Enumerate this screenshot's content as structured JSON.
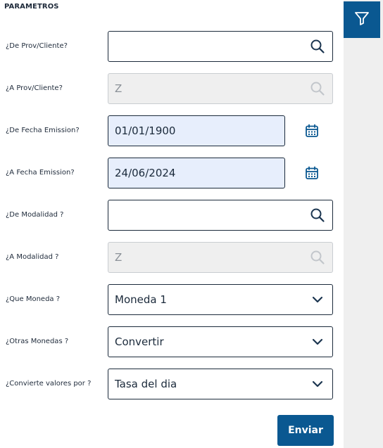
{
  "section_title": "PARAMETROS",
  "fields": [
    {
      "label": "¿De Prov/Cliente?",
      "value": "",
      "type": "lookup",
      "enabled": true
    },
    {
      "label": "¿A Prov/Cliente?",
      "value": "Z",
      "type": "lookup",
      "enabled": false
    },
    {
      "label": "¿De Fecha Emission?",
      "value": "01/01/1900",
      "type": "date",
      "enabled": true
    },
    {
      "label": "¿A Fecha Emission?",
      "value": "24/06/2024",
      "type": "date",
      "enabled": true
    },
    {
      "label": "¿De Modalidad ?",
      "value": "",
      "type": "lookup",
      "enabled": true
    },
    {
      "label": "¿A Modalidad ?",
      "value": "Z",
      "type": "lookup",
      "enabled": false
    },
    {
      "label": "¿Que Moneda ?",
      "value": "Moneda 1",
      "type": "select",
      "enabled": true
    },
    {
      "label": "¿Otras Monedas ?",
      "value": "Convertir",
      "type": "select",
      "enabled": true
    },
    {
      "label": "¿Convierte valores por ?",
      "value": "Tasa del dia",
      "type": "select",
      "enabled": true
    }
  ],
  "submit_label": "Enviar",
  "icons": {
    "filter": "filter-icon",
    "lookup": "search-icon",
    "date": "calendar-icon",
    "select": "chevron-down-icon"
  },
  "colors": {
    "primary": "#0a5891",
    "sidebar": "#efefef",
    "date_field_bg": "#e7eefc",
    "disabled_bg": "#efefef",
    "border": "#1b2a3b"
  }
}
